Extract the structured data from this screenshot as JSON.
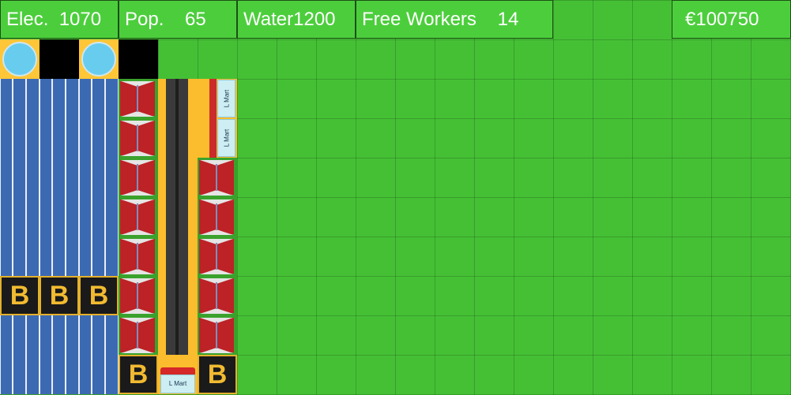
{
  "hud": {
    "electricity_label": "Elec.",
    "electricity_value": "1070",
    "population_label": "Pop.",
    "population_value": "65",
    "water_label": "Water",
    "water_value": "1200",
    "free_workers_label": "Free Workers",
    "free_workers_value": "14",
    "money": "€100750"
  },
  "buildings": {
    "battery_label": "B",
    "shop_label": "L Mart"
  },
  "colors": {
    "grass": "#45c035",
    "hud_panel": "#4cce3c",
    "solar_panel": "#3c6ab2",
    "battery": "#f1ba31",
    "road_edge": "#fbbd2d",
    "house_wall": "#bd2226",
    "water_pool": "#68ccef"
  },
  "tile_types": [
    "water-tower",
    "solar-panel",
    "battery",
    "house",
    "road",
    "shop",
    "empty-lot"
  ]
}
